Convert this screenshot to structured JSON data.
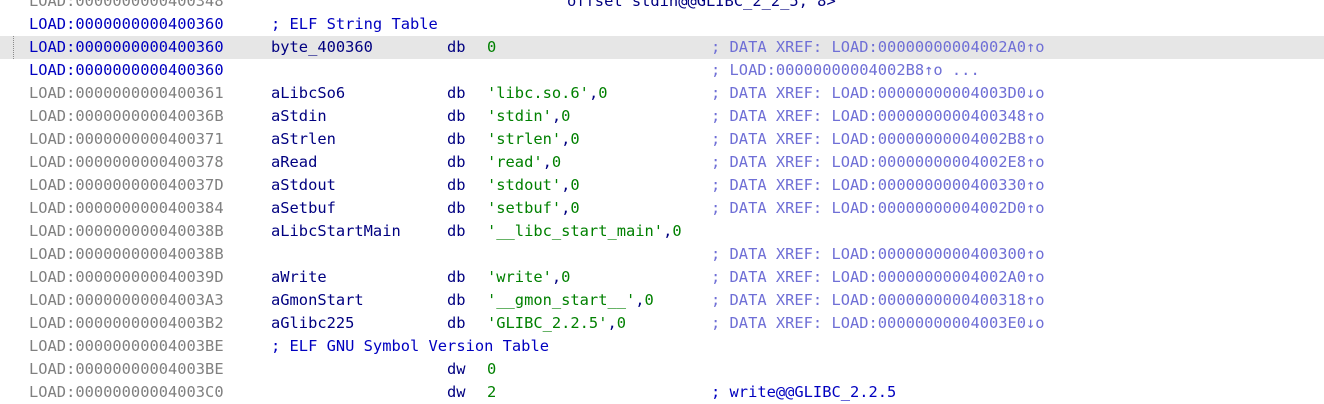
{
  "top_partial": {
    "address": "LOAD:0000000000400348",
    "operand": "offset stdin@@GLIBC_2_2_5, 8>"
  },
  "rows": [
    {
      "address": "LOAD:0000000000400360",
      "section_comment": "; ELF String Table",
      "blue_addr": true
    },
    {
      "address": "LOAD:0000000000400360",
      "name": "byte_400360",
      "instr": "db",
      "ops": [
        {
          "t": "0",
          "k": "num"
        }
      ],
      "comment": "; DATA XREF: LOAD:00000000004002A0↑o",
      "selected": true,
      "blue_addr": true
    },
    {
      "address": "LOAD:0000000000400360",
      "comment": "; LOAD:00000000004002B8↑o ...",
      "blue_addr": true
    },
    {
      "address": "LOAD:0000000000400361",
      "name": "aLibcSo6",
      "instr": "db",
      "ops": [
        {
          "t": "'libc.so.6'",
          "k": "str"
        },
        {
          "t": ",",
          "k": "pun"
        },
        {
          "t": "0",
          "k": "num"
        }
      ],
      "comment": "; DATA XREF: LOAD:00000000004003D0↓o"
    },
    {
      "address": "LOAD:000000000040036B",
      "name": "aStdin",
      "instr": "db",
      "ops": [
        {
          "t": "'stdin'",
          "k": "str"
        },
        {
          "t": ",",
          "k": "pun"
        },
        {
          "t": "0",
          "k": "num"
        }
      ],
      "comment": "; DATA XREF: LOAD:0000000000400348↑o"
    },
    {
      "address": "LOAD:0000000000400371",
      "name": "aStrlen",
      "instr": "db",
      "ops": [
        {
          "t": "'strlen'",
          "k": "str"
        },
        {
          "t": ",",
          "k": "pun"
        },
        {
          "t": "0",
          "k": "num"
        }
      ],
      "comment": "; DATA XREF: LOAD:00000000004002B8↑o"
    },
    {
      "address": "LOAD:0000000000400378",
      "name": "aRead",
      "instr": "db",
      "ops": [
        {
          "t": "'read'",
          "k": "str"
        },
        {
          "t": ",",
          "k": "pun"
        },
        {
          "t": "0",
          "k": "num"
        }
      ],
      "comment": "; DATA XREF: LOAD:00000000004002E8↑o"
    },
    {
      "address": "LOAD:000000000040037D",
      "name": "aStdout",
      "instr": "db",
      "ops": [
        {
          "t": "'stdout'",
          "k": "str"
        },
        {
          "t": ",",
          "k": "pun"
        },
        {
          "t": "0",
          "k": "num"
        }
      ],
      "comment": "; DATA XREF: LOAD:0000000000400330↑o"
    },
    {
      "address": "LOAD:0000000000400384",
      "name": "aSetbuf",
      "instr": "db",
      "ops": [
        {
          "t": "'setbuf'",
          "k": "str"
        },
        {
          "t": ",",
          "k": "pun"
        },
        {
          "t": "0",
          "k": "num"
        }
      ],
      "comment": "; DATA XREF: LOAD:00000000004002D0↑o"
    },
    {
      "address": "LOAD:000000000040038B",
      "name": "aLibcStartMain",
      "instr": "db",
      "ops": [
        {
          "t": "'__libc_start_main'",
          "k": "str"
        },
        {
          "t": ",",
          "k": "pun"
        },
        {
          "t": "0",
          "k": "num"
        }
      ]
    },
    {
      "address": "LOAD:000000000040038B",
      "comment": "; DATA XREF: LOAD:0000000000400300↑o"
    },
    {
      "address": "LOAD:000000000040039D",
      "name": "aWrite",
      "instr": "db",
      "ops": [
        {
          "t": "'write'",
          "k": "str"
        },
        {
          "t": ",",
          "k": "pun"
        },
        {
          "t": "0",
          "k": "num"
        }
      ],
      "comment": "; DATA XREF: LOAD:00000000004002A0↑o"
    },
    {
      "address": "LOAD:00000000004003A3",
      "name": "aGmonStart",
      "instr": "db",
      "ops": [
        {
          "t": "'__gmon_start__'",
          "k": "str"
        },
        {
          "t": ",",
          "k": "pun"
        },
        {
          "t": "0",
          "k": "num"
        }
      ],
      "comment": "; DATA XREF: LOAD:0000000000400318↑o"
    },
    {
      "address": "LOAD:00000000004003B2",
      "name": "aGlibc225",
      "instr": "db",
      "ops": [
        {
          "t": "'GLIBC_2.2.5'",
          "k": "str"
        },
        {
          "t": ",",
          "k": "pun"
        },
        {
          "t": "0",
          "k": "num"
        }
      ],
      "comment": "; DATA XREF: LOAD:00000000004003E0↓o"
    },
    {
      "address": "LOAD:00000000004003BE",
      "section_comment": "; ELF GNU Symbol Version Table"
    },
    {
      "address": "LOAD:00000000004003BE",
      "instr": "dw",
      "ops": [
        {
          "t": "0",
          "k": "num"
        }
      ]
    },
    {
      "address": "LOAD:00000000004003C0",
      "instr": "dw",
      "ops": [
        {
          "t": "2",
          "k": "num"
        }
      ],
      "comment": "; write@@GLIBC_2.2.5",
      "comment_dark": true
    }
  ],
  "colors": {
    "address": "#808080",
    "name": "#000080",
    "string": "#008000",
    "comment": "#6f6fd6",
    "section": "#0000c0",
    "selection": "#e6e6e6"
  }
}
